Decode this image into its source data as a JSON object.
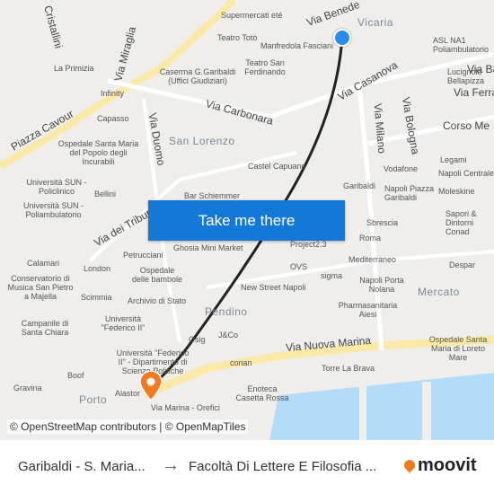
{
  "map": {
    "labels": [
      "Vicaria",
      "Via Benede",
      "ASL NA1 Poliambulatorio",
      "Supermercati eté",
      "Teatro Totò",
      "Manfredola Fasciani",
      "Caserma G.Garibaldi (Uffici Giudiziari)",
      "Teatro San Ferdinando",
      "Via Casanova",
      "Lucignolo Bellapizza",
      "Via Bari",
      "Via Ferrari",
      "Infinity",
      "Via Miraglia",
      "La Primizia",
      "Cristallini",
      "Piazza Cavour",
      "Via Carbonara",
      "Capasso",
      "Via Duomo",
      "San Lorenzo",
      "Ospedale Santa Maria del Popolo degli Incurabili",
      "Via Milano",
      "Via Bologna",
      "Corso Me",
      "Castel Capuano",
      "Vodafone",
      "Legami",
      "Napoli Centrale",
      "Università SUN - Policlinico",
      "Università SUN - Poliambulatorio",
      "Bellini",
      "Bar Schiemmer",
      "Garibaldi",
      "Napoli Piazza Garibaldi",
      "Moleskine",
      "Via dei Tribunali",
      "Ghosia Mini Market",
      "Project2.3",
      "Roma",
      "Sbrescia",
      "Sapori & Dintorni Conad",
      "Calamari",
      "Petrucciani",
      "London",
      "OVS",
      "Mediterraneo",
      "Despar",
      "Conservatorio di Musica San Pietro a Majella",
      "Ospedale delle bambole",
      "New Street Napoli",
      "sigma",
      "Napoli Porta Nolana",
      "Mercato",
      "Scimmia",
      "Archivio di Stato",
      "Pendino",
      "Pharmasanitaria Aiesi",
      "Campanile di Santa Chiara",
      "Università \"Federico II\"",
      "Ospedale Santa Maria di Loreto Mare",
      "Università \"Federico II\" - Dipartimento di Scienze Politiche",
      "Osig",
      "J&Co",
      "Via Nuova Marina",
      "conan",
      "Torre La Brava",
      "Boof",
      "Porto",
      "Alastor",
      "Via Marina - Orefici",
      "Enoteca Casetta Rossa",
      "Gravina"
    ],
    "attribution": "© OpenStreetMap contributors | © OpenMapTiles",
    "colors": {
      "route": "#222222",
      "origin": "#2b8cf0",
      "destination": "#f47a20",
      "water": "#b4dcf8",
      "road": "#ffffff",
      "major_road": "#fbe9a7"
    }
  },
  "cta": {
    "label": "Take me there"
  },
  "footer": {
    "from": "Garibaldi - S. Maria...",
    "arrow": "→",
    "to": "Facoltà Di Lettere E Filosofia ...",
    "brand": "moovit"
  }
}
